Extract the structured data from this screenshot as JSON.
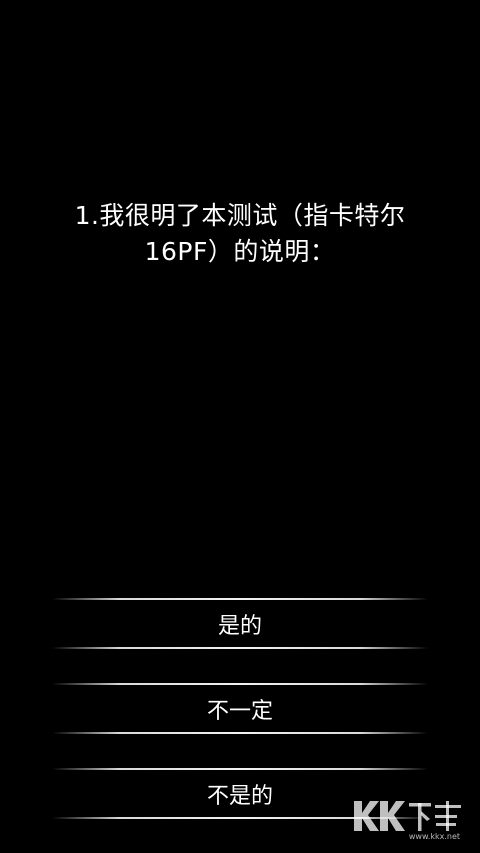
{
  "question": {
    "line1": "1.我很明了本测试（指卡特尔",
    "line2": "16PF）的说明："
  },
  "options": [
    {
      "label": "是的"
    },
    {
      "label": "不一定"
    },
    {
      "label": "不是的"
    }
  ],
  "watermark": {
    "logo_text": "KK下载",
    "url_text": "www.kkx.net"
  },
  "colors": {
    "background": "#000000",
    "text": "#ffffff"
  }
}
